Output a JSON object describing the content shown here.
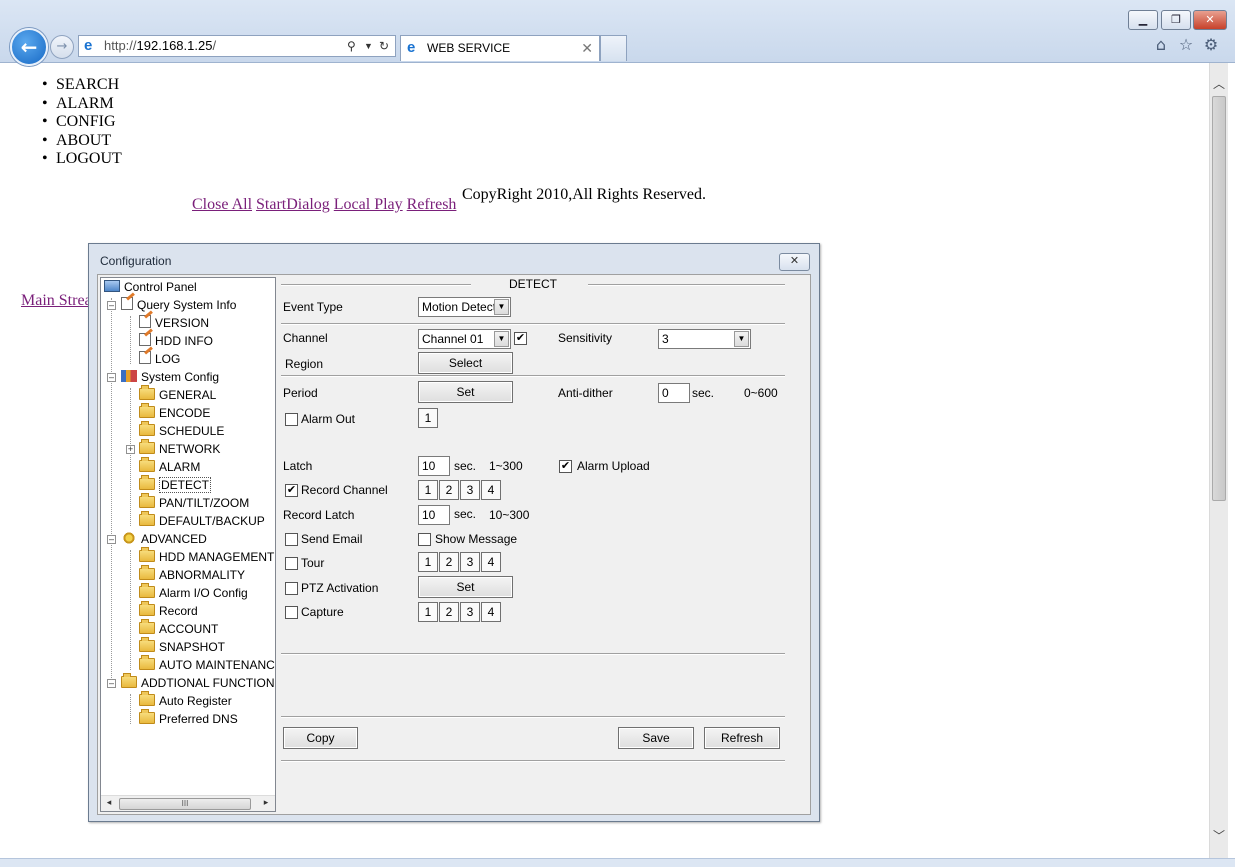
{
  "browser": {
    "url_host": "192.168.1.25",
    "url_prefix": "http://",
    "url_suffix": "/",
    "tab_title": "WEB SERVICE"
  },
  "page": {
    "nav_items": [
      "SEARCH",
      "ALARM",
      "CONFIG",
      "ABOUT",
      "LOGOUT"
    ],
    "links": [
      "Close All",
      "StartDialog",
      "Local Play",
      "Refresh"
    ],
    "copyright": "CopyRight 2010,All Rights Reserved.",
    "main_stream": "Main Strea"
  },
  "dialog": {
    "title": "Configuration",
    "section_title": "DETECT",
    "tree": [
      "Control Panel",
      "Query System Info",
      "VERSION",
      "HDD INFO",
      "LOG",
      "System Config",
      "GENERAL",
      "ENCODE",
      "SCHEDULE",
      "NETWORK",
      "ALARM",
      "DETECT",
      "PAN/TILT/ZOOM",
      "DEFAULT/BACKUP",
      "ADVANCED",
      "HDD MANAGEMENT",
      "ABNORMALITY",
      "Alarm I/O Config",
      "Record",
      "ACCOUNT",
      "SNAPSHOT",
      "AUTO MAINTENANCE",
      "ADDTIONAL FUNCTION",
      "Auto Register",
      "Preferred DNS"
    ],
    "form": {
      "event_type_label": "Event Type",
      "event_type_value": "Motion Detect",
      "channel_label": "Channel",
      "channel_value": "Channel 01",
      "sensitivity_label": "Sensitivity",
      "sensitivity_value": "3",
      "region_label": "Region",
      "select_button": "Select",
      "period_label": "Period",
      "set_button": "Set",
      "anti_dither_label": "Anti-dither",
      "anti_dither_value": "0",
      "sec_unit": "sec.",
      "anti_dither_range": "0~600",
      "alarm_out_label": "Alarm Out",
      "alarm_out_channel": "1",
      "latch_label": "Latch",
      "latch_value": "10",
      "latch_range": "1~300",
      "alarm_upload_label": "Alarm Upload",
      "record_channel_label": "Record Channel",
      "record_latch_label": "Record Latch",
      "record_latch_value": "10",
      "record_latch_range": "10~300",
      "send_email_label": "Send Email",
      "show_message_label": "Show Message",
      "tour_label": "Tour",
      "ptz_activation_label": "PTZ Activation",
      "capture_label": "Capture",
      "channels": [
        "1",
        "2",
        "3",
        "4"
      ]
    },
    "checks": {
      "channel_enabled": true,
      "alarm_out": false,
      "alarm_upload": true,
      "record_channel": true,
      "send_email": false,
      "show_message": false,
      "tour": false,
      "ptz_activation": false,
      "capture": false
    },
    "footer": {
      "copy_button": "Copy",
      "save_button": "Save",
      "refresh_button": "Refresh"
    },
    "scroll_glyph": "III"
  }
}
